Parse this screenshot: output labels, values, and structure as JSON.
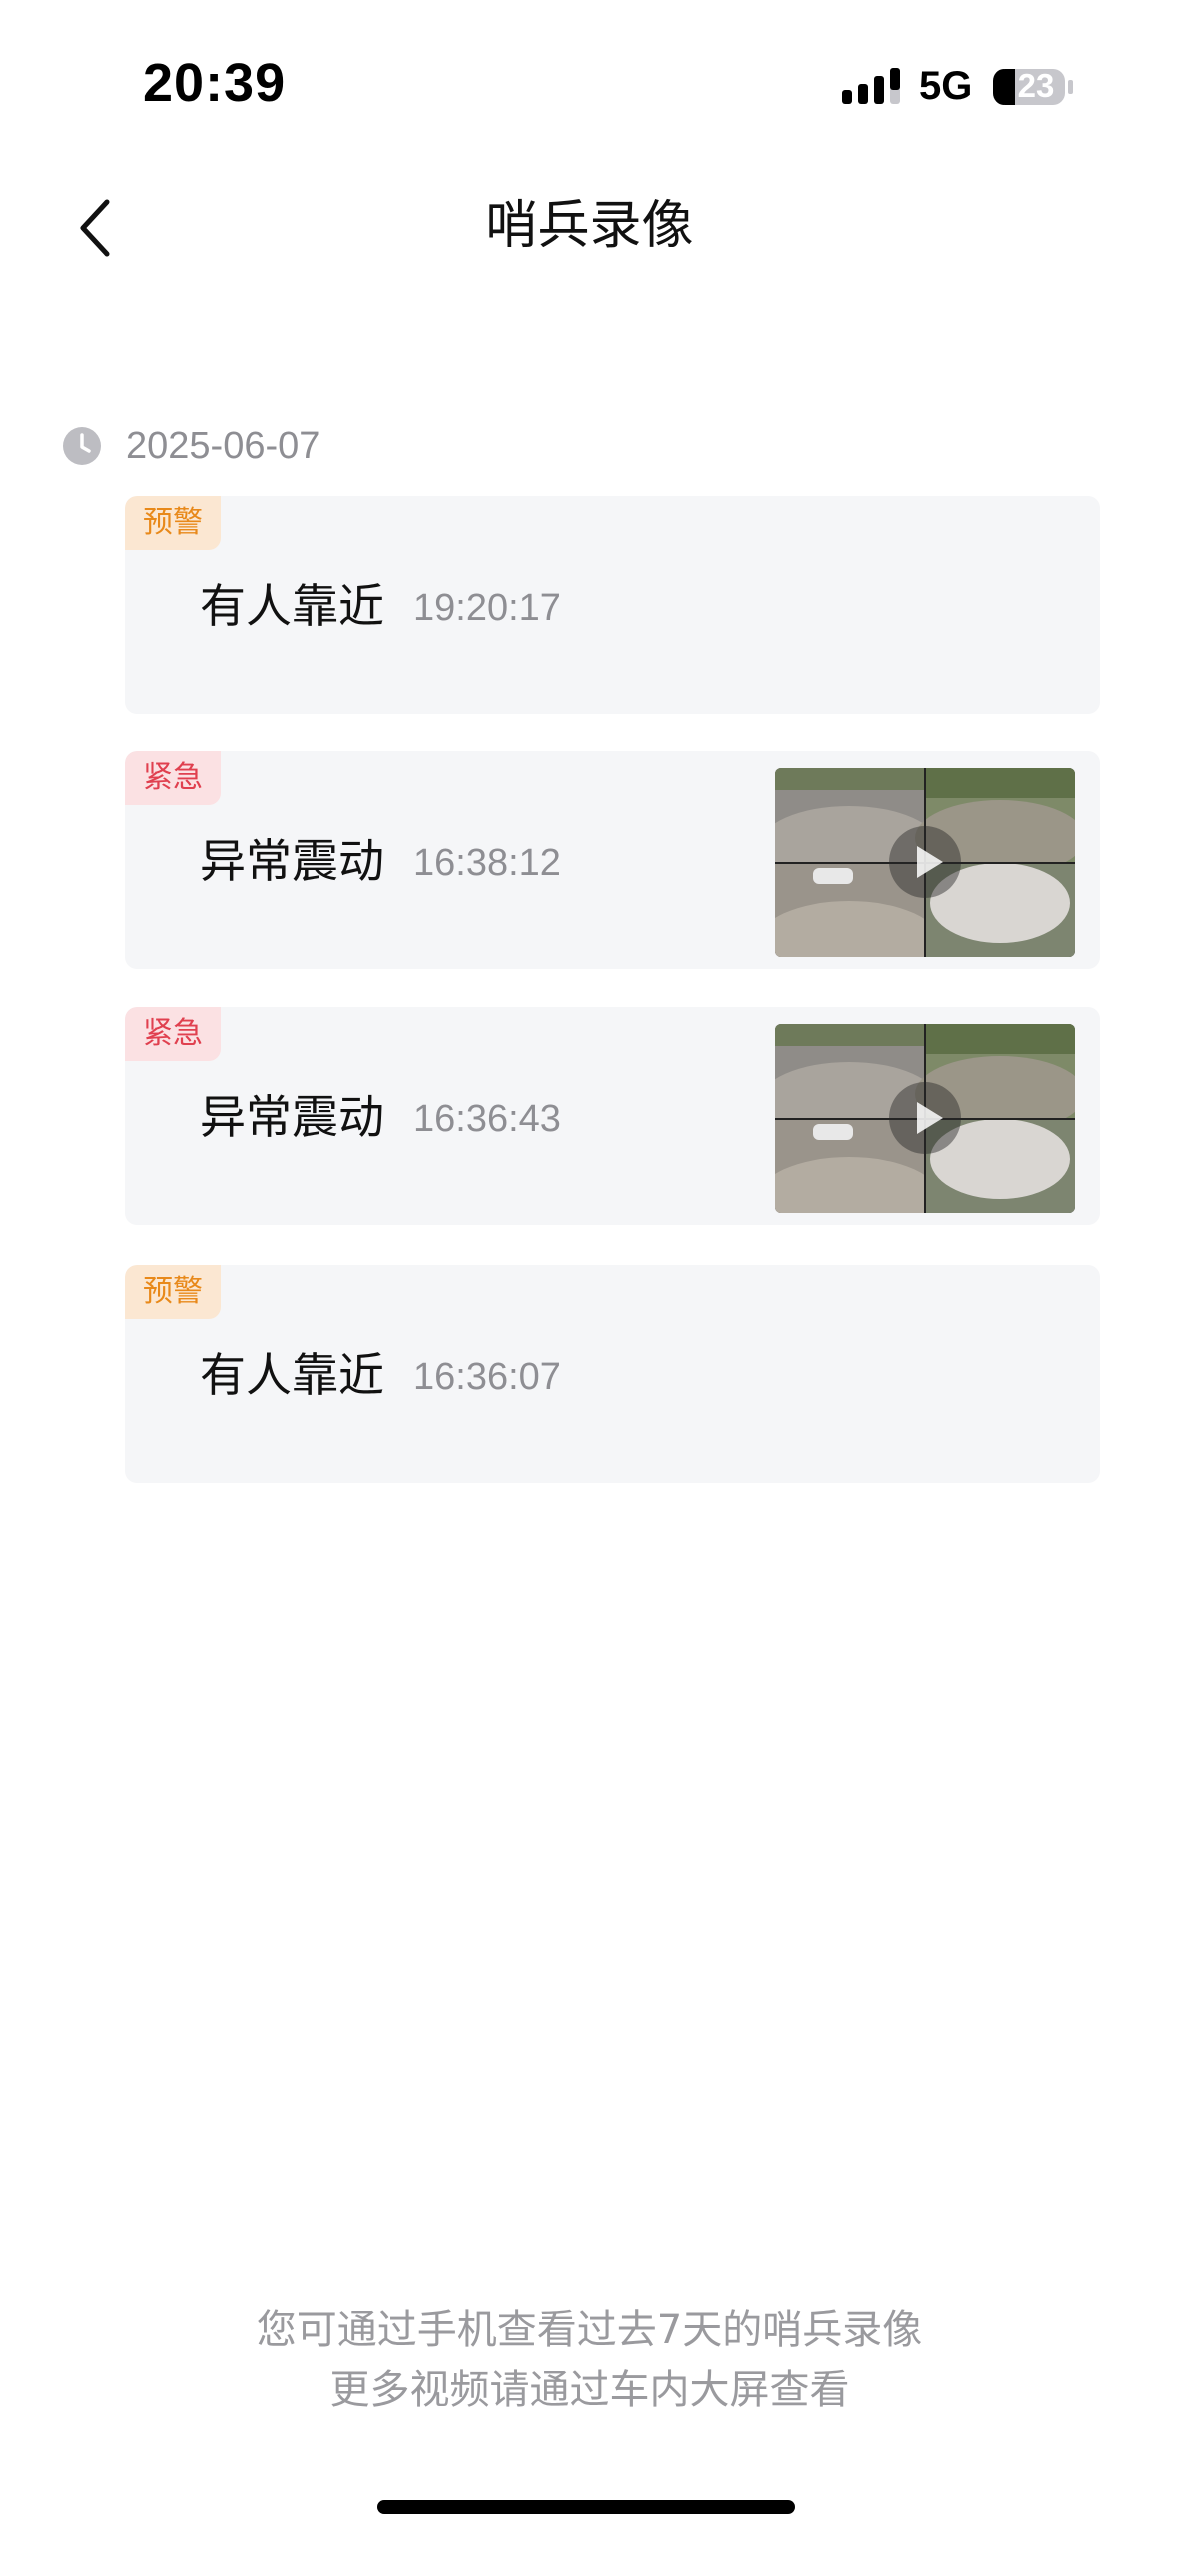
{
  "status_bar": {
    "time": "20:39",
    "network": "5G",
    "battery": "23",
    "icons": [
      "signal-icon",
      "battery-icon"
    ]
  },
  "header": {
    "title": "哨兵录像",
    "back_icon": "chevron-left-icon"
  },
  "date_group": {
    "date": "2025-06-07",
    "icon": "clock-icon"
  },
  "records": [
    {
      "level": "预警",
      "type": "warning",
      "event": "有人靠近",
      "time": "19:20:17",
      "has_video": false
    },
    {
      "level": "紧急",
      "type": "urgent",
      "event": "异常震动",
      "time": "16:38:12",
      "has_video": true
    },
    {
      "level": "紧急",
      "type": "urgent",
      "event": "异常震动",
      "time": "16:36:43",
      "has_video": true
    },
    {
      "level": "预警",
      "type": "warning",
      "event": "有人靠近",
      "time": "16:36:07",
      "has_video": false
    }
  ],
  "footer": {
    "line1": "您可通过手机查看过去7天的哨兵录像",
    "line2": "更多视频请通过车内大屏查看"
  },
  "colors": {
    "warning_bg": "#fbe7d2",
    "warning_text": "#e8891a",
    "urgent_bg": "#fbe1e3",
    "urgent_text": "#e0404f",
    "card_bg": "#f5f6f8",
    "secondary_text": "#8e8e93"
  }
}
